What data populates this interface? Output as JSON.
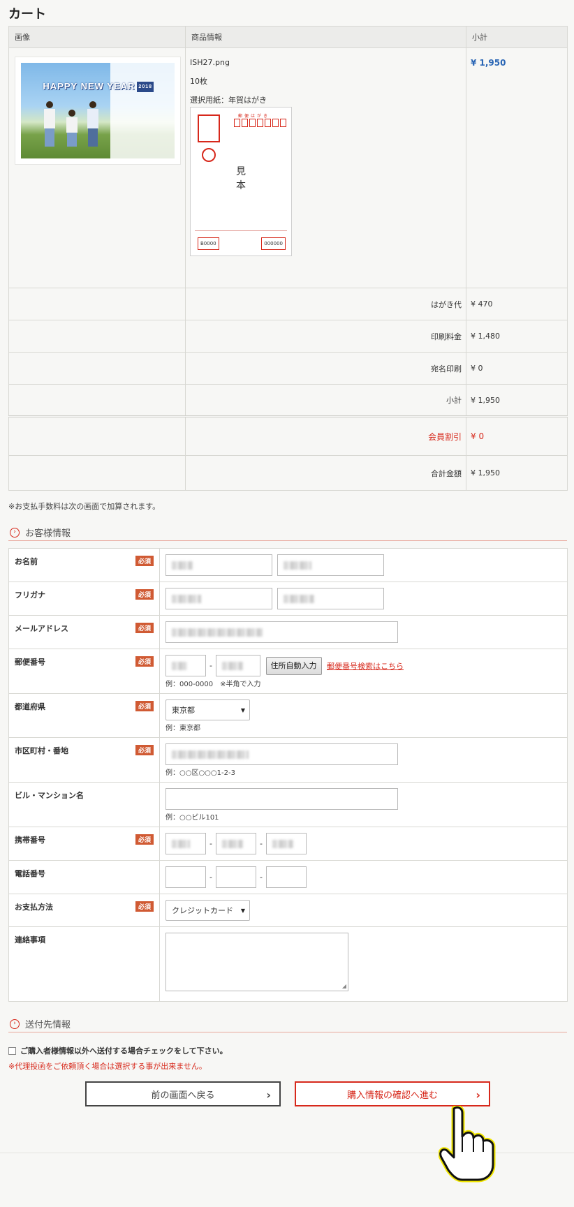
{
  "page_title": "カート",
  "cart": {
    "headers": [
      "画像",
      "商品情報",
      "小計"
    ],
    "product": {
      "filename": "ISH27.png",
      "quantity": "10枚",
      "paper": "選択用紙：年賀はがき",
      "price": "¥ 1,950",
      "thumb_text": "HAPPY NEW YEAR",
      "thumb_year": "2018",
      "sample_label": "見本",
      "postcard_num_left": "B0000",
      "postcard_num_right": "000000"
    },
    "summary": [
      {
        "label": "はがき代",
        "value": "¥ 470"
      },
      {
        "label": "印刷料金",
        "value": "¥ 1,480"
      },
      {
        "label": "宛名印刷",
        "value": "¥ 0"
      },
      {
        "label": "小計",
        "value": "¥ 1,950"
      }
    ],
    "discount": {
      "label": "会員割引",
      "value": "¥ 0"
    },
    "total": {
      "label": "合計金額",
      "value": "¥ 1,950"
    }
  },
  "note": "※お支払手数料は次の画面で加算されます。",
  "customer_section": {
    "heading": "お客様情報",
    "required_badge": "必須",
    "fields": {
      "name": "お名前",
      "furigana": "フリガナ",
      "email": "メールアドレス",
      "postal": "郵便番号",
      "prefecture": "都道府県",
      "city": "市区町村・番地",
      "building": "ビル・マンション名",
      "mobile": "携帯番号",
      "phone": "電話番号",
      "payment": "お支払方法",
      "message": "連絡事項"
    },
    "postal_example": "例：000-0000　※半角で入力",
    "postal_button": "住所自動入力",
    "postal_link": "郵便番号検索はこちら",
    "prefecture_value": "東京都",
    "prefecture_example": "例：東京都",
    "city_example": "例：○○区○○○1-2-3",
    "building_example": "例：○○ビル101",
    "payment_value": "クレジットカード",
    "dash": "-"
  },
  "shipping_section": {
    "heading": "送付先情報",
    "checkbox_label": "ご購入者様情報以外へ送付する場合チェックをして下さい。",
    "warning": "※代理投函をご依頼頂く場合は選択する事が出来ません。"
  },
  "buttons": {
    "back": "前の画面へ戻る",
    "next": "購入情報の確認へ進む"
  },
  "colors": {
    "accent_red": "#d7281b",
    "price_blue": "#2a66b5",
    "required_bg": "#d05a33"
  }
}
